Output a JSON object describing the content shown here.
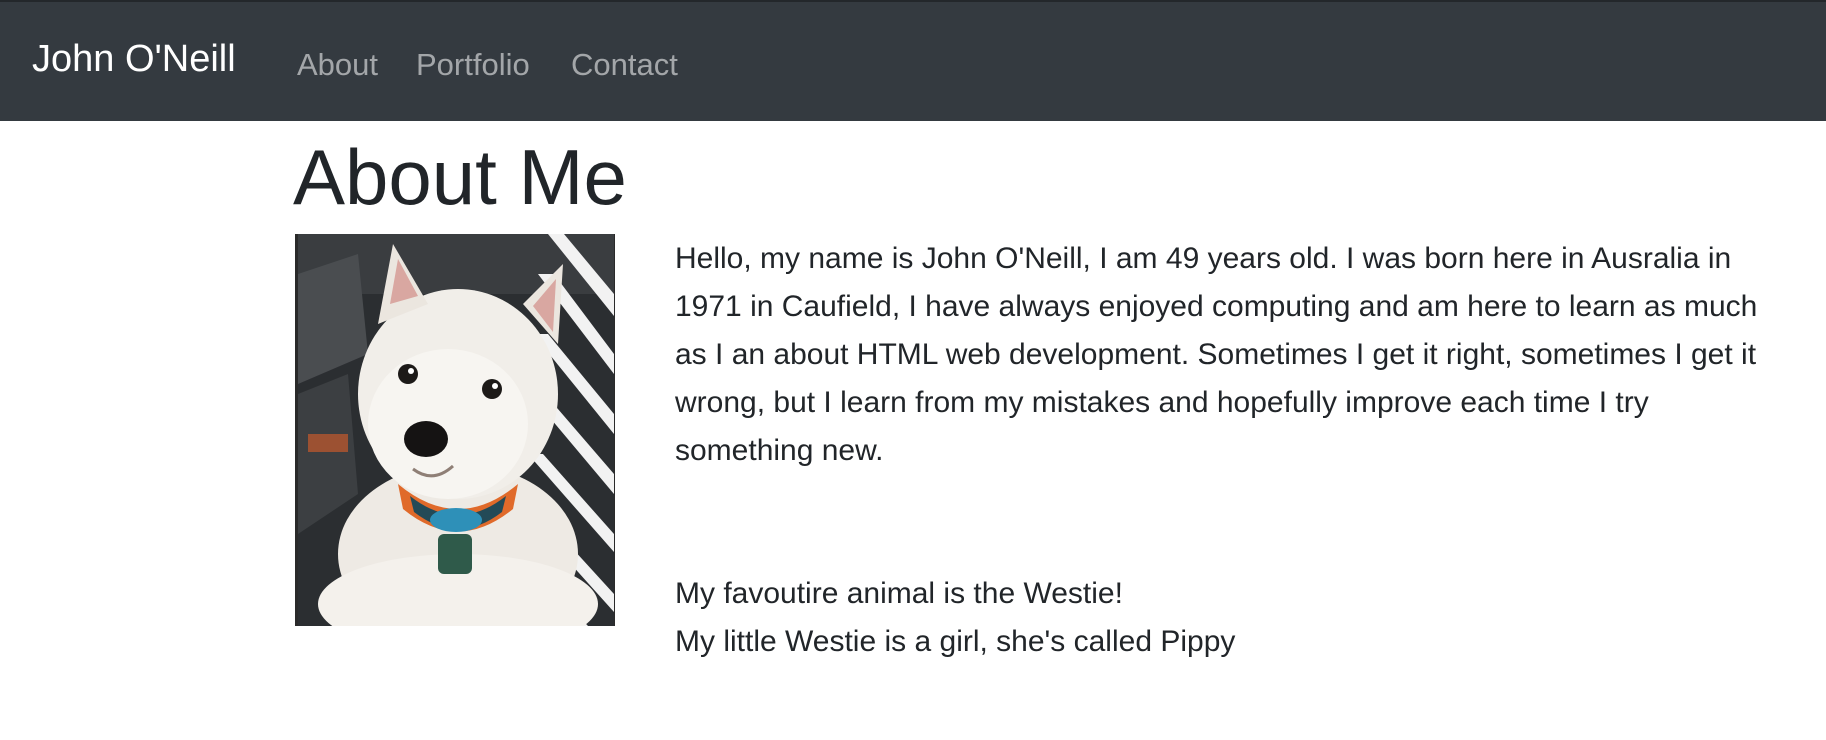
{
  "navbar": {
    "brand": "John O'Neill",
    "links": [
      "About",
      "Portfolio",
      "Contact"
    ]
  },
  "main": {
    "title": "About Me",
    "photo_alt": "West Highland White Terrier puppy wearing a harness",
    "bio": "Hello, my name is John O'Neill, I am 49 years old. I was born here in Ausralia in 1971 in Caufield, I have always enjoyed computing and am here to learn as much as I an about HTML web development. Sometimes I get it right, sometimes I get it wrong, but I learn from my mistakes and hopefully improve each time I try something new.",
    "favourite_line": "My favoutire animal is the Westie!",
    "pet_line": "My little Westie is a girl, she's called Pippy"
  },
  "colors": {
    "navbar_bg": "#343a40",
    "brand_text": "#ffffff",
    "nav_link": "rgba(255,255,255,0.55)",
    "body_text": "#212529"
  }
}
